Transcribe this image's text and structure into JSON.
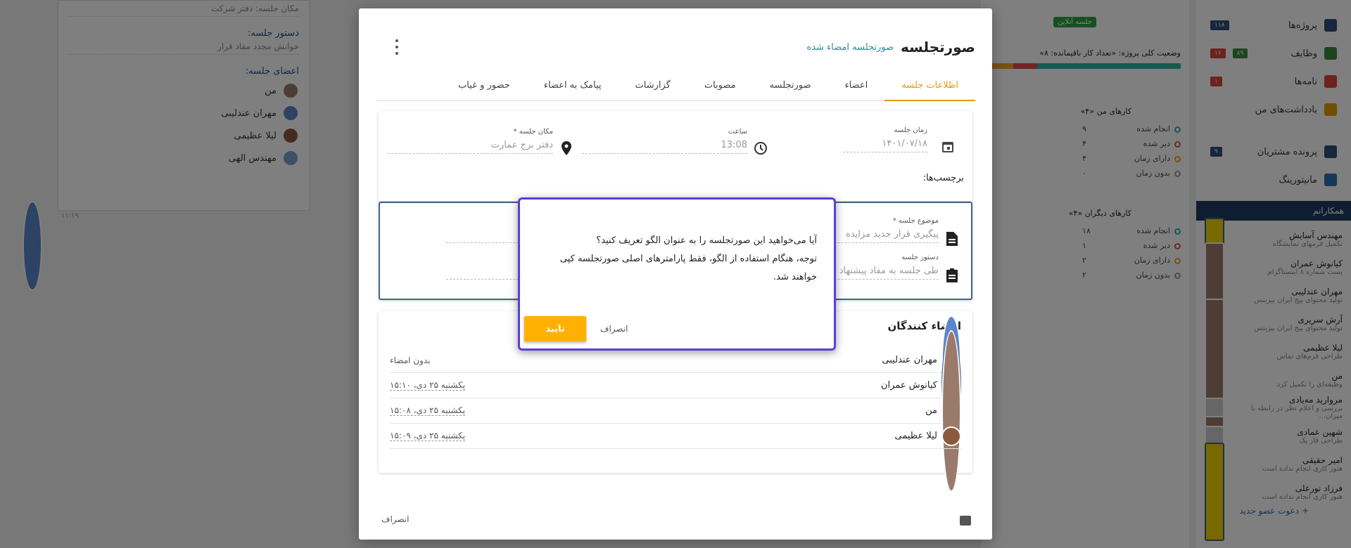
{
  "background": {
    "left_panel": {
      "location_line": "مکان جلسه: دفتر شرکت",
      "agenda_heading": "دستور جلسه:",
      "agenda_line": "خوانش مجدد مفاد قرار",
      "members_heading": "اعضای جلسه:",
      "members": [
        "من",
        "مهران عندلیبی",
        "لیلا عظیمی",
        "مهندس الهی"
      ],
      "time": "۱۱:۱۹"
    },
    "middle_panel": {
      "online_badge": "جلسه آنلاین",
      "status_title": "وضعیت کلی پروژه: «تعداد کار باقیمانده: ۸»",
      "my_tasks_title": "کارهای من «۴»",
      "my_tasks": [
        {
          "label": "انجام شده",
          "count": "۹"
        },
        {
          "label": "دیر شده",
          "count": "۴"
        },
        {
          "label": "دارای زمان",
          "count": "۴"
        },
        {
          "label": "بدون زمان",
          "count": "۰"
        }
      ],
      "others_tasks_title": "کارهای دیگران «۴»",
      "others_tasks": [
        {
          "label": "انجام شده",
          "count": "۱۸"
        },
        {
          "label": "دیر شده",
          "count": "۱"
        },
        {
          "label": "دارای زمان",
          "count": "۲"
        },
        {
          "label": "بدون زمان",
          "count": "۲"
        }
      ]
    },
    "sidebar": {
      "items": [
        {
          "label": "پروژه‌ها",
          "badge": "۱۱۸",
          "color": "#2f4f78"
        },
        {
          "label": "وظایف",
          "badge": "۸۹",
          "badge2": "۱۶",
          "color": "#3b8a3b"
        },
        {
          "label": "نامه‌ها",
          "badge": "۱",
          "color": "#d9453a"
        },
        {
          "label": "یادداشت‌های من",
          "badge": "",
          "color": "#e0a000"
        },
        {
          "label": "پرونده مشتریان",
          "badge": "۹",
          "color": "#2f4f78"
        },
        {
          "label": "مانیتورینگ",
          "badge": "",
          "color": "#2f6fb0"
        }
      ],
      "colleagues_heading": "همکارانم",
      "colleagues": [
        {
          "name": "مهندس آسایش",
          "desc": "تکمیل فرمهای نمایشگاه"
        },
        {
          "name": "کیانوش عمران",
          "desc": "پست شماره ۸ اینستاگرام"
        },
        {
          "name": "مهران عندلیبی",
          "desc": "تولید محتوای پیج ایران بیزینس"
        },
        {
          "name": "آرش سریری",
          "desc": "تولید محتوای پیج ایران بیزینس"
        },
        {
          "name": "لیلا عظیمی",
          "desc": "طراحی فرم‌های تماس"
        },
        {
          "name": "من",
          "desc": "وظیفه‌ای را تکمیل کرد"
        },
        {
          "name": "مروارید مه‌یادی",
          "desc": "بررسی و اعلام نظر در رابطه با میزان..."
        },
        {
          "name": "شهین عمادی",
          "desc": "طراحی فاز یک"
        },
        {
          "name": "امیر حقیقی",
          "desc": "هنوز کاری انجام نداده است"
        },
        {
          "name": "فرزاد نورعلی",
          "desc": "هنوز کاری انجام نداده است"
        }
      ],
      "invite_link": "+ دعوت عضو جدید"
    }
  },
  "modal": {
    "title": "صورتجلسه",
    "subtitle": "صورتجلسه امضاء شده",
    "tabs": [
      "اطلاعات جلسه",
      "اعضاء",
      "صورتجلسه",
      "مصوبات",
      "گزارشات",
      "پیامک به اعضاء",
      "حضور و غیاب"
    ],
    "active_tab": "اطلاعات جلسه",
    "info": {
      "date_label": "زمان جلسه",
      "date_value": "۱۴۰۱/۰۷/۱۸",
      "time_label": "ساعت",
      "time_value": "13:08",
      "place_label": "مکان جلسه *",
      "place_value": "دفتر برج عمارت",
      "tags_label": "برچسب‌ها:"
    },
    "subject": {
      "topic_label": "موضوع جلسه *",
      "topic_value": "پیگیری قرار جدید مزایده",
      "agenda_label": "دستور جلسه",
      "agenda_value": "طی جلسه به مفاد پیشنهاد"
    },
    "signers": {
      "heading": "امضاء کنندگان",
      "rows": [
        {
          "name": "مهران عندلیبی",
          "status": "بدون امضاء"
        },
        {
          "name": "کیانوش عمران",
          "status": "یکشنبه ۲۵ دی،  ۱۵:۱۰"
        },
        {
          "name": "من",
          "status": "یکشنبه ۲۵ دی،  ۱۵:۰۸"
        },
        {
          "name": "لیلا عظیمی",
          "status": "یکشنبه ۲۵ دی،  ۱۵:۰۹"
        }
      ]
    },
    "footer_cancel": "انصراف"
  },
  "dialog": {
    "line1": "آیا می‌خواهید این صورتجلسه را به عنوان الگو تعریف کنید؟",
    "line2": "توجه، هنگام استفاده از الگو، فقط پارامترهای اصلی صورتجلسه کپی خواهند شد.",
    "confirm": "تایید",
    "cancel": "انصراف",
    "accent": "#ffb000",
    "border": "#5b3fd8"
  }
}
